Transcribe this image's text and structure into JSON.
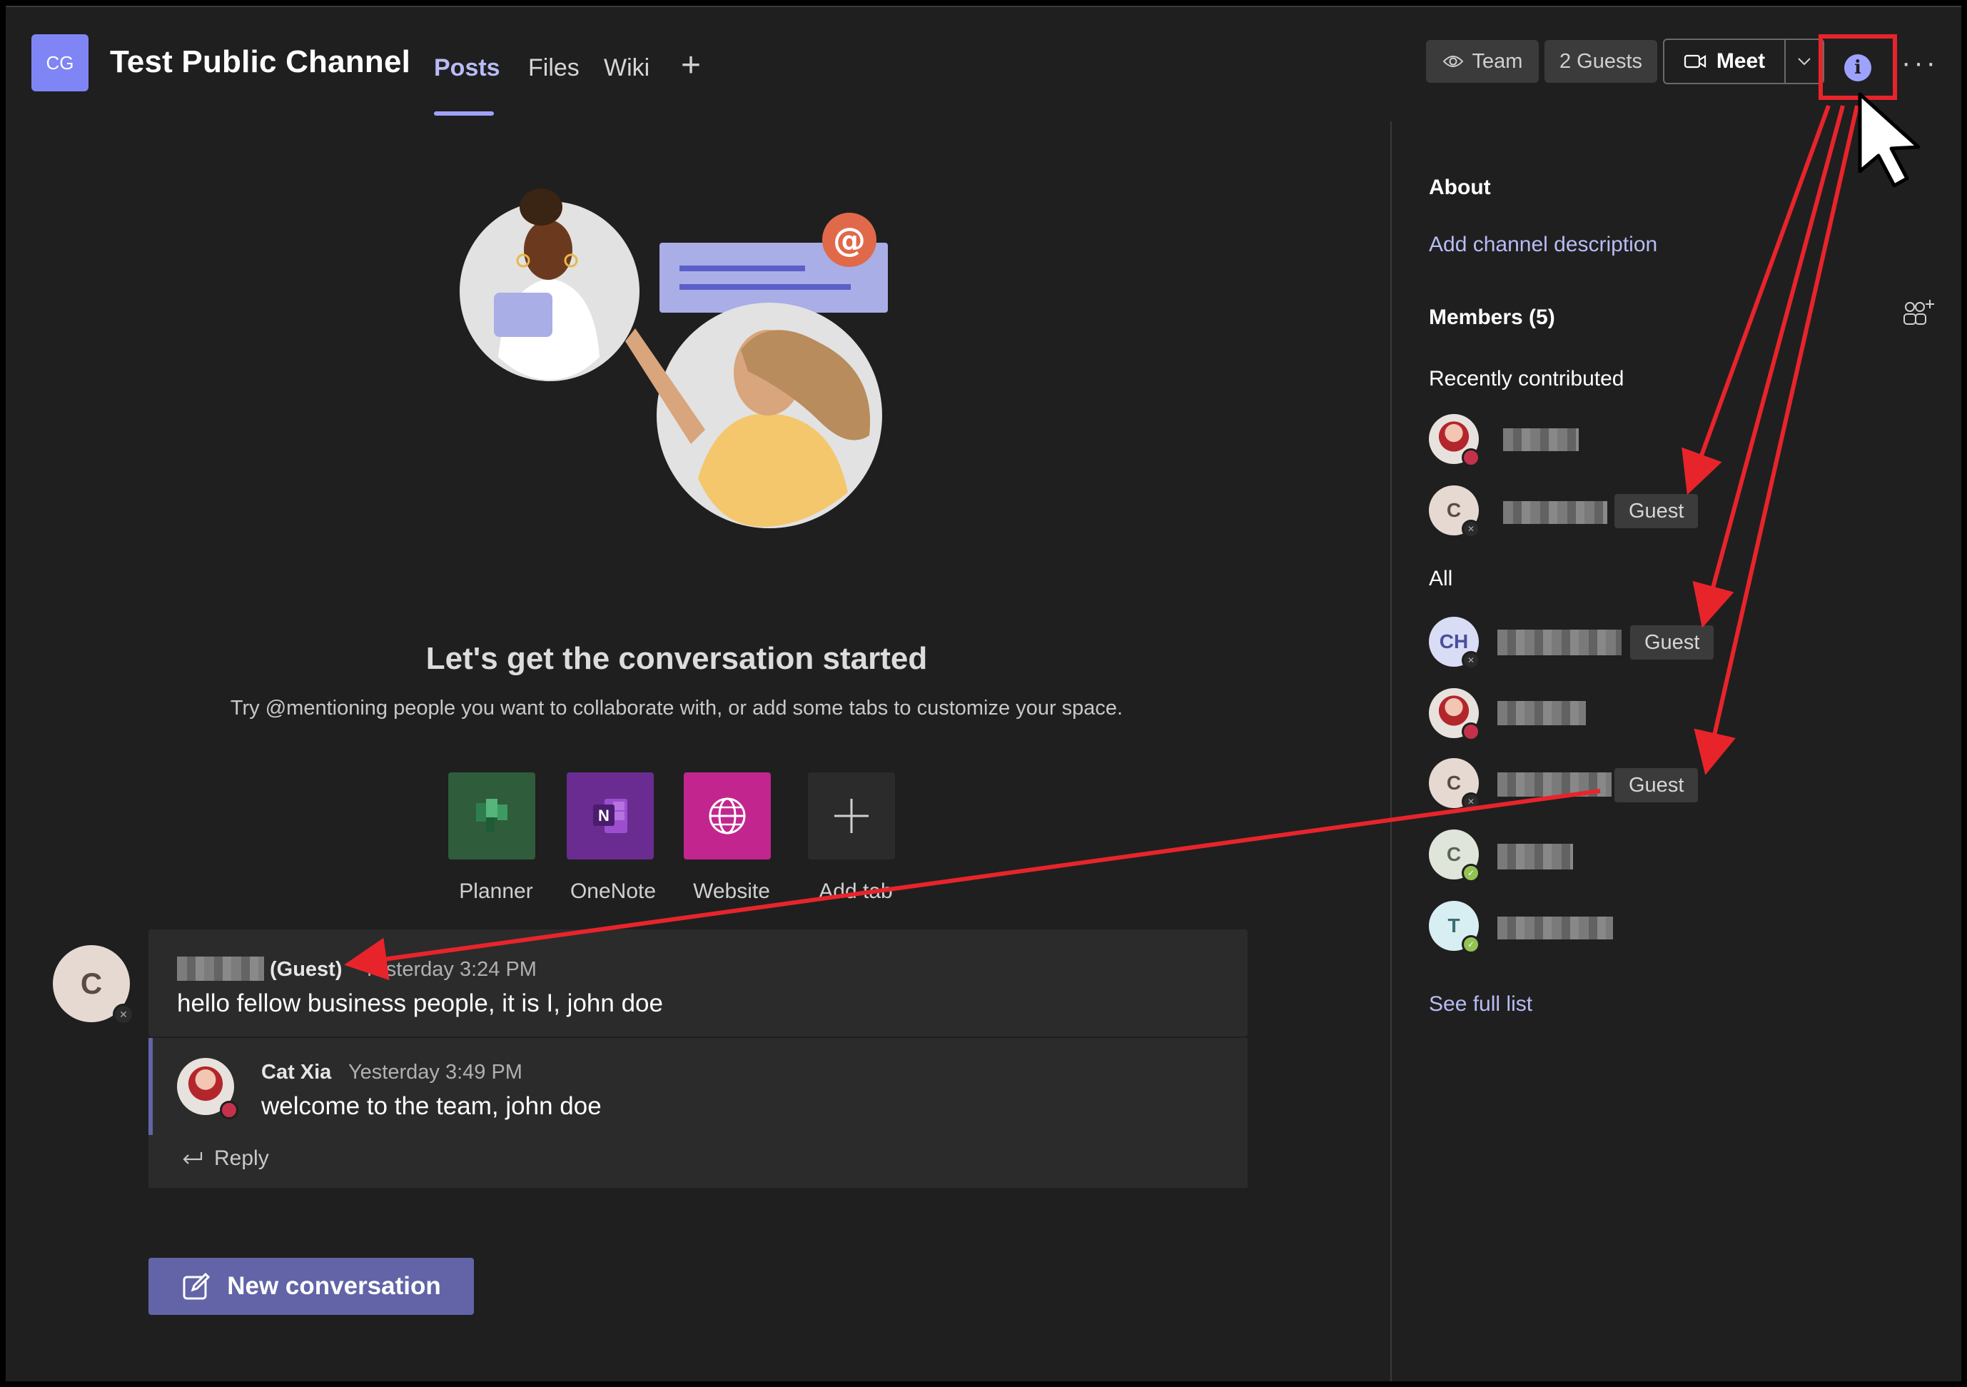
{
  "header": {
    "team_initials": "CG",
    "channel_title": "Test Public Channel",
    "tabs": [
      {
        "label": "Posts",
        "active": true
      },
      {
        "label": "Files",
        "active": false
      },
      {
        "label": "Wiki",
        "active": false
      }
    ],
    "add_tab_symbol": "+",
    "team_button_label": "Team",
    "guests_button_label": "2 Guests",
    "meet_label": "Meet",
    "info_symbol": "i",
    "more_symbol": "···"
  },
  "empty_state": {
    "title": "Let's get the conversation started",
    "subtitle": "Try @mentioning people you want to collaborate with, or add some tabs to customize your space."
  },
  "apps": [
    {
      "label": "Planner",
      "icon": "planner-icon",
      "color": "#2f5c3a"
    },
    {
      "label": "OneNote",
      "icon": "onenote-icon",
      "color": "#6a2c91"
    },
    {
      "label": "Website",
      "icon": "globe-icon",
      "color": "#c2268e"
    },
    {
      "label": "Add tab",
      "icon": "plus-icon",
      "color": "#2b2b2b"
    }
  ],
  "thread": {
    "post": {
      "avatar_initial": "C",
      "author_suffix": "(Guest)",
      "time": "Yesterday 3:24 PM",
      "body": "hello fellow business people, it is I, john doe"
    },
    "reply": {
      "author": "Cat Xia",
      "time": "Yesterday 3:49 PM",
      "body": "welcome to the team, john doe"
    },
    "reply_label": "Reply"
  },
  "new_conversation_label": "New conversation",
  "panel": {
    "about_heading": "About",
    "add_description_link": "Add channel description",
    "members_heading": "Members (5)",
    "recent_heading": "Recently contributed",
    "all_heading": "All",
    "guest_badge": "Guest",
    "see_full_list": "See full list",
    "recent_members": [
      {
        "initials": "",
        "photo": true,
        "status": "busy",
        "guest": false
      },
      {
        "initials": "C",
        "photo": false,
        "status": "offline",
        "guest": true
      }
    ],
    "all_members": [
      {
        "initials": "CH",
        "photo": false,
        "status": "offline",
        "guest": true
      },
      {
        "initials": "",
        "photo": true,
        "status": "busy",
        "guest": false
      },
      {
        "initials": "C",
        "photo": false,
        "status": "offline",
        "guest": true
      },
      {
        "initials": "C",
        "photo": false,
        "status": "available",
        "guest": false
      },
      {
        "initials": "T",
        "photo": false,
        "status": "available",
        "guest": false
      }
    ]
  },
  "colors": {
    "accent": "#6264a7",
    "accent_light": "#b8bcf5",
    "annotation_red": "#e8242b",
    "busy": "#c4314b",
    "available": "#92c353"
  }
}
